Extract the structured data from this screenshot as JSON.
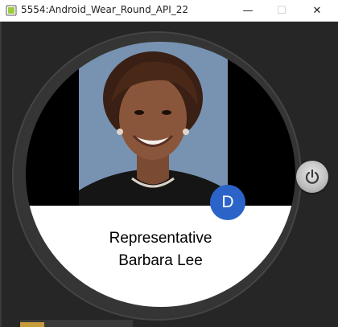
{
  "window": {
    "title": "5554:Android_Wear_Round_API_22",
    "minimize_label": "—",
    "maximize_label": "☐",
    "close_label": "✕",
    "icon": "android-emulator-icon"
  },
  "watch": {
    "representative_title": "Representative",
    "representative_name": "Barbara Lee",
    "party_badge": "D",
    "party_color": "#2b63c9",
    "photo": "portrait-photo",
    "power_icon": "power-icon"
  }
}
